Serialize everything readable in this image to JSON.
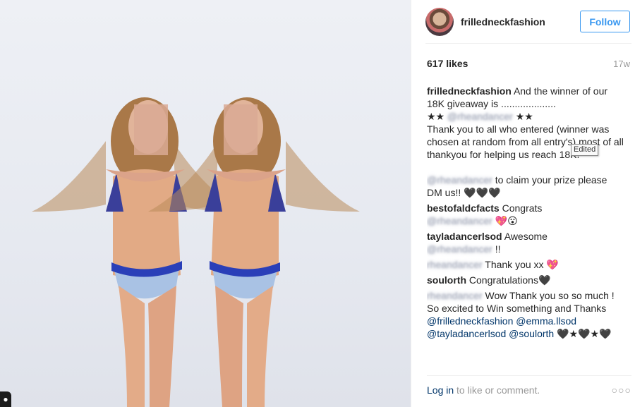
{
  "post": {
    "username": "frilledneckfashion",
    "follow_label": "Follow",
    "likes": "617 likes",
    "age": "17w",
    "edited_tooltip": "Edited"
  },
  "comments": [
    {
      "user": "frilledneckfashion",
      "text": "And the winner of our 18K giveaway is ....................",
      "line2_pre": "★★",
      "line2_mention": "@rheandancer",
      "line2_post": "★★",
      "line3": "Thank you to all who entered (winner was chosen at random from all entry's) most of all thankyou for helping us reach 18K!"
    },
    {
      "user": "@rheandancer",
      "text": "to claim your prize please DM us!! 🖤🖤🖤"
    },
    {
      "user": "bestofaldcfacts",
      "text": "Congrats",
      "mention": "@rheandancer",
      "tail": "💖😮"
    },
    {
      "user": "tayladancerlsod",
      "text": "Awesome",
      "mention": "@rheandancer",
      "tail": "!!"
    },
    {
      "user": "rheandancer",
      "text": "Thank you xx 💖"
    },
    {
      "user": "soulorth",
      "text": "Congratulations🖤"
    },
    {
      "user": "rheandancer",
      "text": "Wow Thank you so so much ! So excited to Win something and Thanks",
      "mentions": [
        "@frilledneckfashion",
        "@emma.llsod",
        "@tayladancerlsod",
        "@soulorth"
      ],
      "tail": "🖤★🖤★🖤"
    }
  ],
  "footer": {
    "login_link": "Log in",
    "login_rest": " to like or comment.",
    "more": "○○○"
  },
  "icons": {
    "corner": "person-icon",
    "more": "more-options-icon"
  }
}
